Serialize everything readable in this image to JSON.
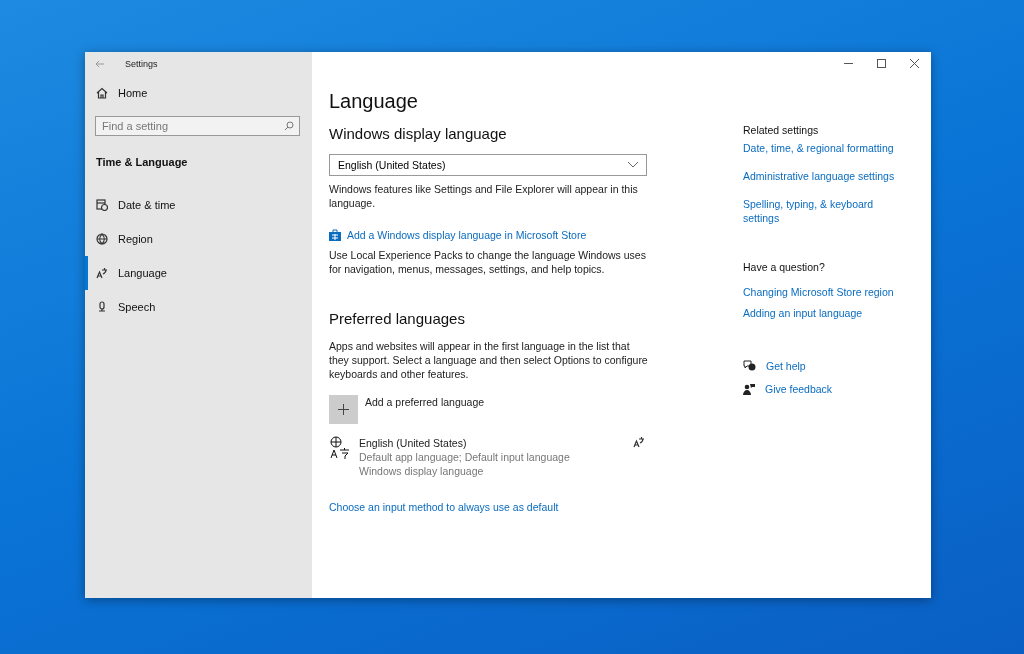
{
  "window": {
    "title": "Settings"
  },
  "sidebar": {
    "home": "Home",
    "search": {
      "placeholder": "Find a setting"
    },
    "section": "Time & Language",
    "items": [
      {
        "label": "Date & time",
        "selected": false
      },
      {
        "label": "Region",
        "selected": false
      },
      {
        "label": "Language",
        "selected": true
      },
      {
        "label": "Speech",
        "selected": false
      }
    ]
  },
  "main": {
    "title": "Language",
    "display_language": {
      "heading": "Windows display language",
      "value": "English (United States)",
      "description": "Windows features like Settings and File Explorer will appear in this language.",
      "store_link": "Add a Windows display language in Microsoft Store",
      "note": "Use Local Experience Packs to change the language Windows uses for navigation, menus, messages, settings, and help topics."
    },
    "preferred": {
      "heading": "Preferred languages",
      "description": "Apps and websites will appear in the first language in the list that they support. Select a language and then select Options to configure keyboards and other features.",
      "add_label": "Add a preferred language",
      "languages": [
        {
          "name": "English (United States)",
          "details": [
            "Default app language; Default input language",
            "Windows display language"
          ]
        }
      ],
      "link": "Choose an input method to always use as default"
    }
  },
  "related": {
    "heading": "Related settings",
    "links": [
      "Date, time, & regional formatting",
      "Administrative language settings",
      "Spelling, typing, & keyboard settings"
    ],
    "question_heading": "Have a question?",
    "question_links": [
      "Changing Microsoft Store region",
      "Adding an input language"
    ],
    "help": [
      {
        "kind": "help",
        "label": "Get help"
      },
      {
        "kind": "feedback",
        "label": "Give feedback"
      }
    ]
  }
}
